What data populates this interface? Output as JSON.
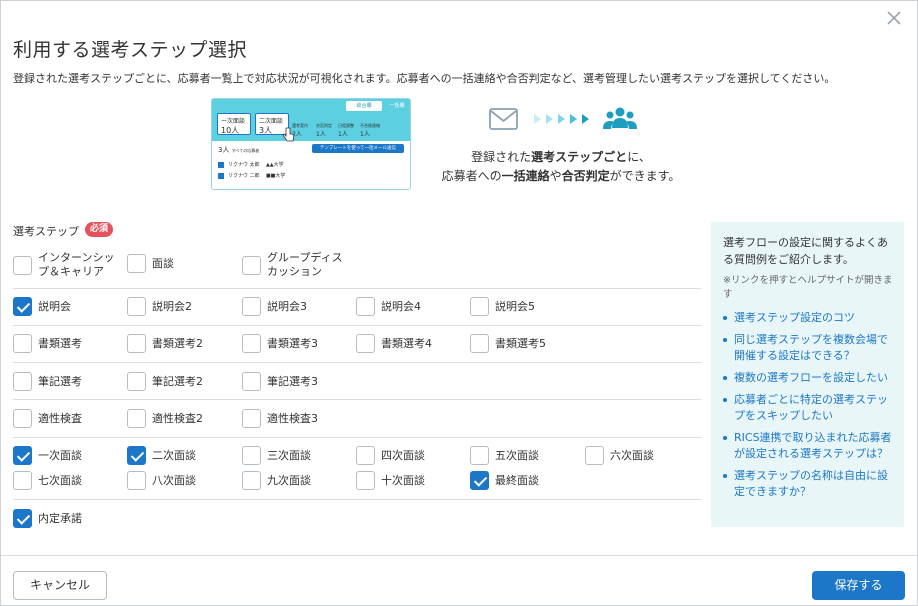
{
  "modal": {
    "title": "利用する選考ステップ選択",
    "description": "登録された選考ステップごとに、応募者一覧上で対応状況が可視化されます。応募者への一括連絡や合否判定など、選考管理したい選考ステップを選択してください。"
  },
  "illustration": {
    "tab_general": "総合欄",
    "tab_list": "一括欄",
    "box1_label": "一次面談",
    "box1_value": "10人",
    "box2_label": "二次面談",
    "box2_value": "3人",
    "stat1_label": "選考案内",
    "stat1_value": "2人",
    "stat2_label": "合否判定",
    "stat2_value": "1人",
    "stat3_label": "日程調整",
    "stat3_value": "1人",
    "stat4_label": "不合格連絡",
    "stat4_value": "1人",
    "count_text": "3人",
    "count_sub": "すべての応募者",
    "template_button": "テンプレートを使って一括メール送信",
    "row1": "リクナウ 太郎",
    "row1_school": "▲▲大学",
    "row2": "リクナウ 二郎",
    "row2_school": "■■大学",
    "caption_line1_a": "登録された",
    "caption_line1_b": "選考ステップごと",
    "caption_line1_c": "に、",
    "caption_line2_a": "応募者への",
    "caption_line2_b": "一括連絡",
    "caption_line2_c": "や",
    "caption_line2_d": "合否判定",
    "caption_line2_e": "ができます。"
  },
  "steps": {
    "label": "選考ステップ",
    "required_badge": "必須",
    "items": [
      {
        "label": "インターンシップ＆キャリア",
        "line1": "インターンシッ",
        "line2": "プ＆キャリア",
        "checked": false
      },
      {
        "label": "面談",
        "checked": false
      },
      {
        "label": "グループディスカッション",
        "line1": "グループディス",
        "line2": "カッション",
        "checked": false
      },
      {
        "label": "説明会",
        "checked": true
      },
      {
        "label": "説明会2",
        "checked": false
      },
      {
        "label": "説明会3",
        "checked": false
      },
      {
        "label": "説明会4",
        "checked": false
      },
      {
        "label": "説明会5",
        "checked": false
      },
      {
        "label": "書類選考",
        "checked": false
      },
      {
        "label": "書類選考2",
        "checked": false
      },
      {
        "label": "書類選考3",
        "checked": false
      },
      {
        "label": "書類選考4",
        "checked": false
      },
      {
        "label": "書類選考5",
        "checked": false
      },
      {
        "label": "筆記選考",
        "checked": false
      },
      {
        "label": "筆記選考2",
        "checked": false
      },
      {
        "label": "筆記選考3",
        "checked": false
      },
      {
        "label": "適性検査",
        "checked": false
      },
      {
        "label": "適性検査2",
        "checked": false
      },
      {
        "label": "適性検査3",
        "checked": false
      },
      {
        "label": "一次面談",
        "checked": true
      },
      {
        "label": "二次面談",
        "checked": true
      },
      {
        "label": "三次面談",
        "checked": false
      },
      {
        "label": "四次面談",
        "checked": false
      },
      {
        "label": "五次面談",
        "checked": false
      },
      {
        "label": "六次面談",
        "checked": false
      },
      {
        "label": "七次面談",
        "checked": false
      },
      {
        "label": "八次面談",
        "checked": false
      },
      {
        "label": "九次面談",
        "checked": false
      },
      {
        "label": "十次面談",
        "checked": false
      },
      {
        "label": "最終面談",
        "checked": true
      },
      {
        "label": "内定承諾",
        "checked": true
      }
    ]
  },
  "faq": {
    "heading": "選考フローの設定に関するよくある質問例をご紹介します。",
    "note": "※リンクを押すとヘルプサイトが開きます",
    "links": [
      "選考ステップ設定のコツ",
      "同じ選考ステップを複数会場で開催する設定はできる？",
      "複数の選考フローを設定したい",
      "応募者ごとに特定の選考ステップをスキップしたい",
      "RICS連携で取り込まれた応募者が設定される選考ステップは？",
      "選考ステップの名称は自由に設定できますか？"
    ]
  },
  "footer": {
    "cancel": "キャンセル",
    "save": "保存する"
  },
  "colors": {
    "primary": "#1d77c9",
    "required": "#e4525e",
    "faq_bg": "#e9f6f8",
    "illustration_accent": "#5ccfe0"
  }
}
